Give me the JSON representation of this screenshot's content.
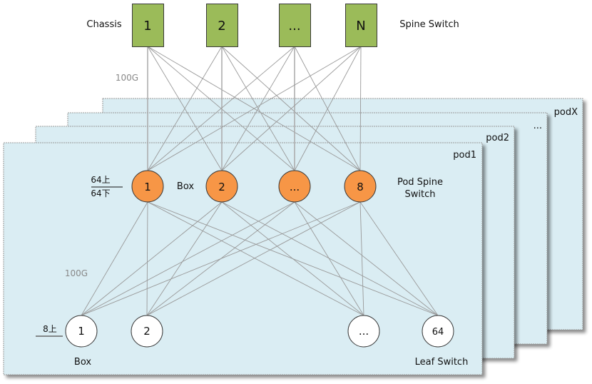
{
  "spine": {
    "left_label": "Chassis",
    "right_label": "Spine Switch",
    "nodes": [
      "1",
      "2",
      "...",
      "N"
    ],
    "color": "#9BBB59"
  },
  "uplink_speed": "100G",
  "pods": {
    "labels": [
      "podX",
      "...",
      "pod2",
      "pod1"
    ],
    "fill": "#DAEDF3"
  },
  "pod_spine": {
    "nodes": [
      "1",
      "2",
      "...",
      "8"
    ],
    "label_line1": "Pod Spine",
    "label_line2": "Switch",
    "box_label": "Box",
    "ratio_top": "64上",
    "ratio_bottom": "64下",
    "color": "#F79646"
  },
  "downlink_speed": "100G",
  "leaf": {
    "nodes": [
      "1",
      "2",
      "...",
      "64"
    ],
    "label": "Leaf Switch",
    "box_label": "Box",
    "ratio_top": "8上"
  }
}
